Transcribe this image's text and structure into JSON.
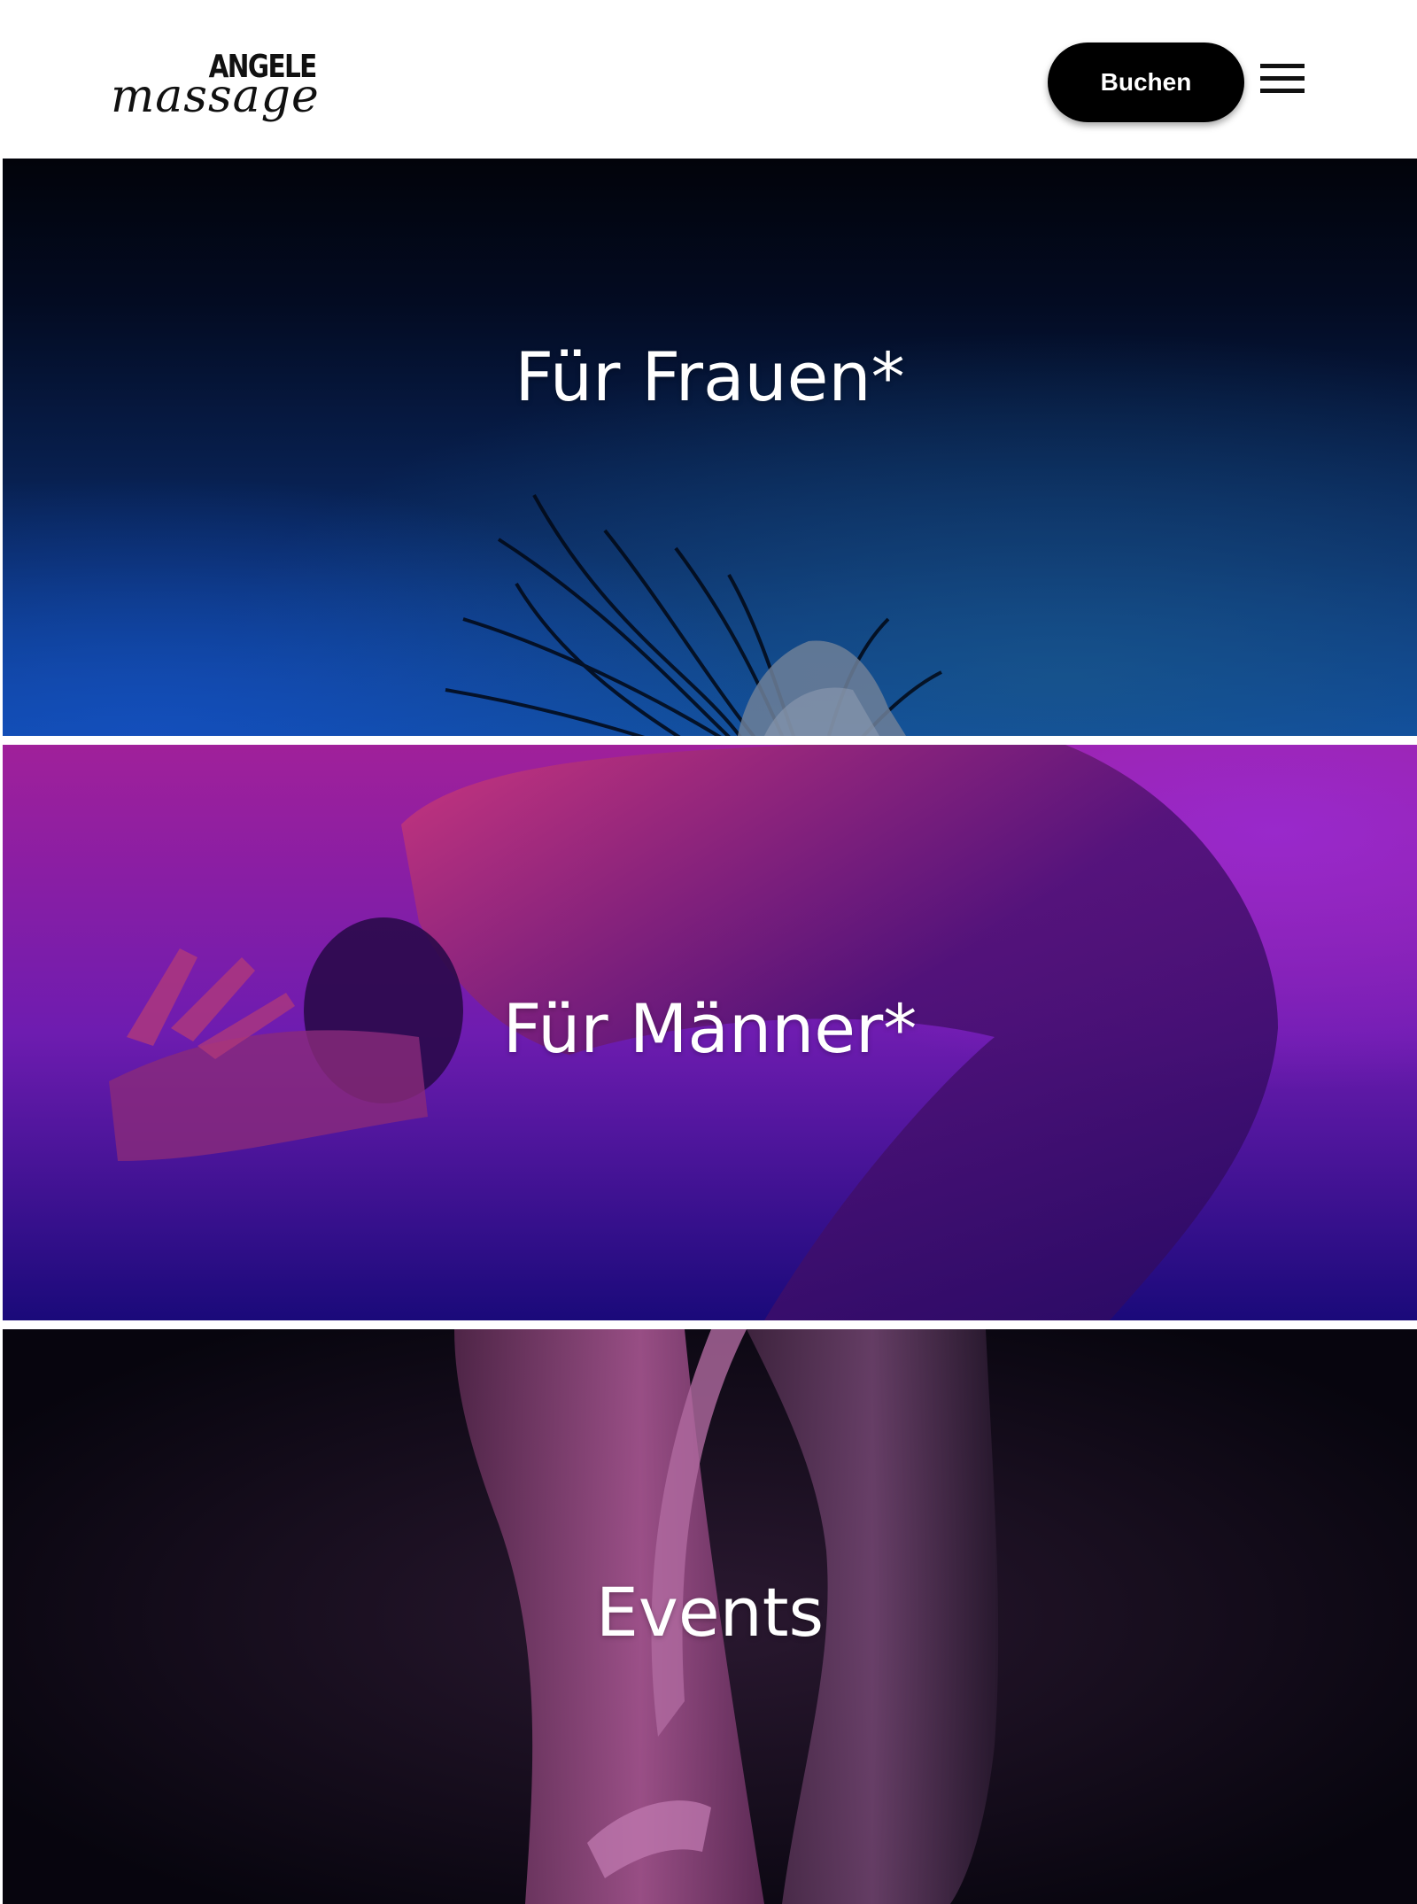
{
  "brand": {
    "logo_top": "ANGELE",
    "logo_script": "massage"
  },
  "header": {
    "book_label": "Buchen",
    "menu_icon": "hamburger-menu-icon"
  },
  "tiles": [
    {
      "title": "Für Frauen*",
      "accent": "#0f3a8a"
    },
    {
      "title": "Für Männer*",
      "accent": "#8b22b8"
    },
    {
      "title": "Events",
      "accent": "#3a1a3f"
    }
  ],
  "colors": {
    "header_bg": "#ffffff",
    "button_bg": "#000000",
    "button_text": "#ffffff",
    "tile_text": "#ffffff"
  }
}
